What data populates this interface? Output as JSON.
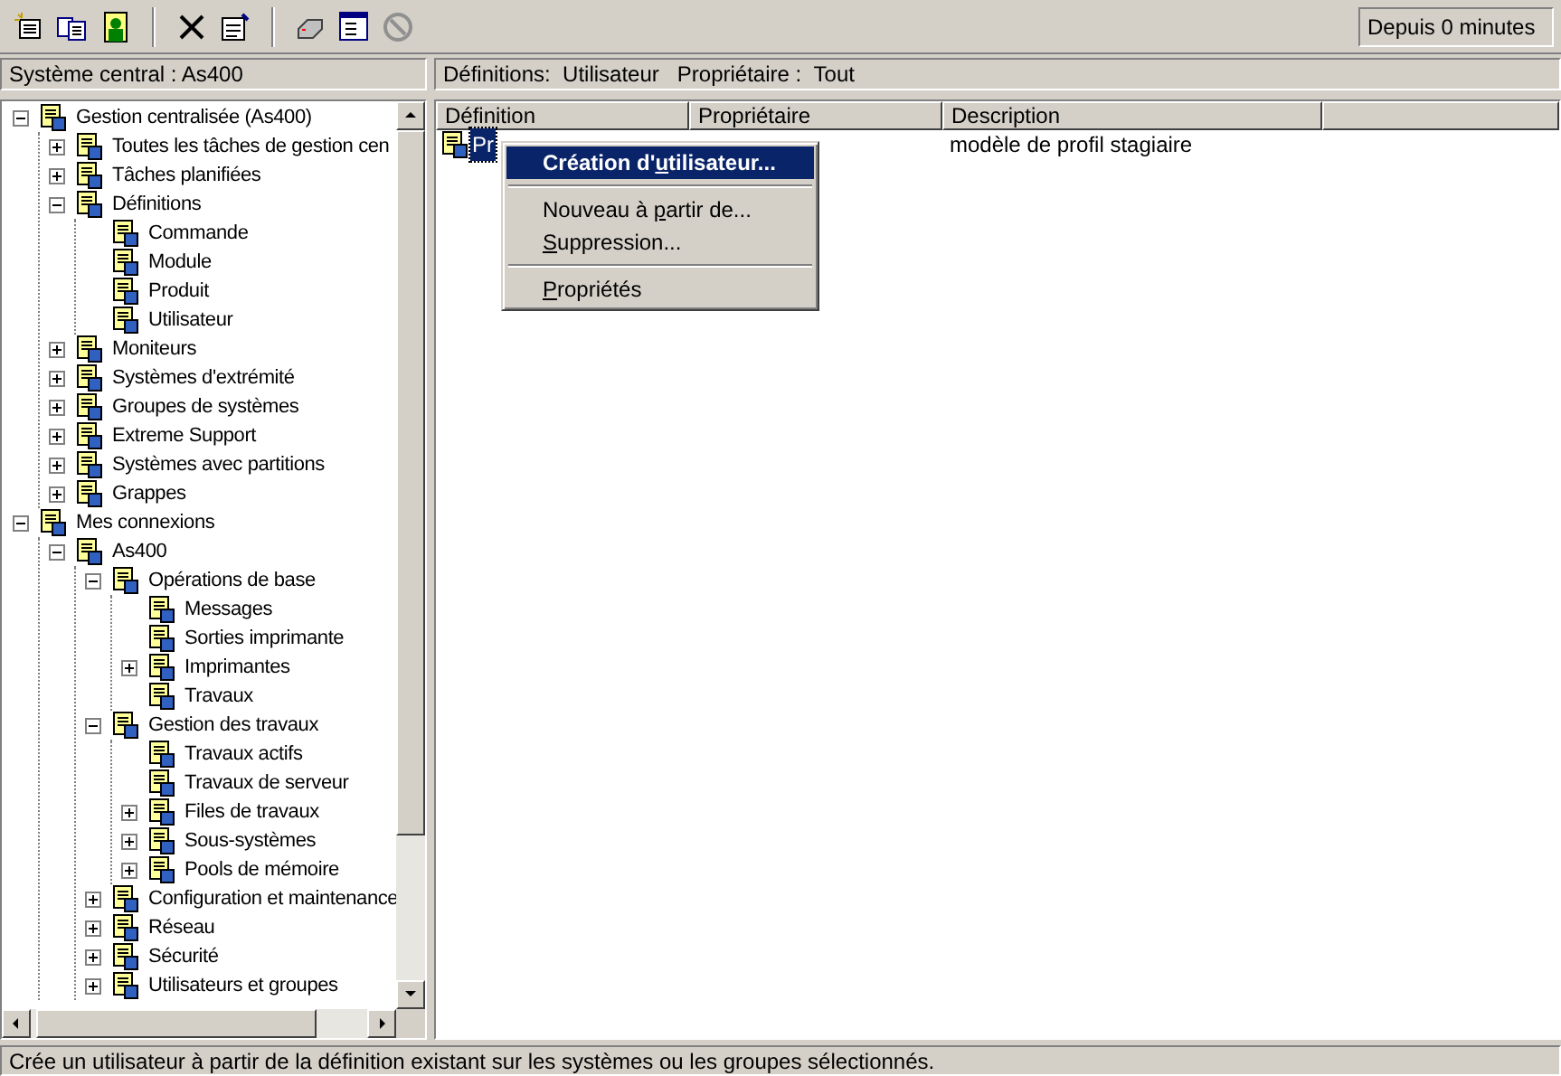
{
  "toolbar": {
    "buttons": [
      {
        "kind": "new"
      },
      {
        "kind": "copy"
      },
      {
        "kind": "user"
      },
      {
        "kind": "separator"
      },
      {
        "kind": "delete"
      },
      {
        "kind": "properties"
      },
      {
        "kind": "separator"
      },
      {
        "kind": "print"
      },
      {
        "kind": "view"
      },
      {
        "kind": "stop",
        "disabled": true
      }
    ],
    "status": "Depuis 0 minutes"
  },
  "left_header": "Système central : As400",
  "right_header": {
    "label1": "Définitions:",
    "value1": "Utilisateur",
    "label2": "Propriétaire :",
    "value2": "Tout"
  },
  "tree": [
    {
      "label": "Gestion centralisée (As400)",
      "expanded": true,
      "children": [
        {
          "label": "Toutes les tâches de gestion cen",
          "expanded": false
        },
        {
          "label": "Tâches planifiées",
          "expanded": false
        },
        {
          "label": "Définitions",
          "expanded": true,
          "children": [
            {
              "label": "Commande"
            },
            {
              "label": "Module"
            },
            {
              "label": "Produit"
            },
            {
              "label": "Utilisateur"
            }
          ]
        },
        {
          "label": "Moniteurs",
          "expanded": false
        },
        {
          "label": "Systèmes d'extrémité",
          "expanded": false
        },
        {
          "label": "Groupes de systèmes",
          "expanded": false
        },
        {
          "label": "Extreme Support",
          "expanded": false
        },
        {
          "label": "Systèmes avec partitions",
          "expanded": false
        },
        {
          "label": "Grappes",
          "expanded": false
        }
      ]
    },
    {
      "label": "Mes connexions",
      "expanded": true,
      "children": [
        {
          "label": "As400",
          "expanded": true,
          "children": [
            {
              "label": "Opérations de base",
              "expanded": true,
              "children": [
                {
                  "label": "Messages"
                },
                {
                  "label": "Sorties imprimante"
                },
                {
                  "label": "Imprimantes",
                  "expanded": false
                },
                {
                  "label": "Travaux"
                }
              ]
            },
            {
              "label": "Gestion des travaux",
              "expanded": true,
              "children": [
                {
                  "label": "Travaux actifs"
                },
                {
                  "label": "Travaux de serveur"
                },
                {
                  "label": "Files de travaux",
                  "expanded": false
                },
                {
                  "label": "Sous-systèmes",
                  "expanded": false
                },
                {
                  "label": "Pools de mémoire",
                  "expanded": false
                }
              ]
            },
            {
              "label": "Configuration et maintenance",
              "expanded": false
            },
            {
              "label": "Réseau",
              "expanded": false
            },
            {
              "label": "Sécurité",
              "expanded": false
            },
            {
              "label": "Utilisateurs et groupes",
              "expanded": false
            }
          ]
        }
      ]
    }
  ],
  "table": {
    "columns": [
      "Définition",
      "Propriétaire",
      "Description"
    ],
    "rows": [
      {
        "definition": "Pr",
        "description": "modèle de profil stagiaire",
        "selected": true
      }
    ]
  },
  "context_menu": [
    {
      "kind": "item",
      "before": "Création d'",
      "key": "u",
      "after": "tilisateur...",
      "selected": true
    },
    {
      "kind": "separator"
    },
    {
      "kind": "item",
      "before": "Nouveau à ",
      "key": "p",
      "after": "artir de...",
      "selected": false
    },
    {
      "kind": "item",
      "key": "S",
      "after": "uppression...",
      "selected": false
    },
    {
      "kind": "separator"
    },
    {
      "kind": "item",
      "key": "P",
      "after": "ropriétés",
      "selected": false
    }
  ],
  "status_bar": "Crée un utilisateur à partir de la définition existant sur les systèmes ou les groupes sélectionnés."
}
